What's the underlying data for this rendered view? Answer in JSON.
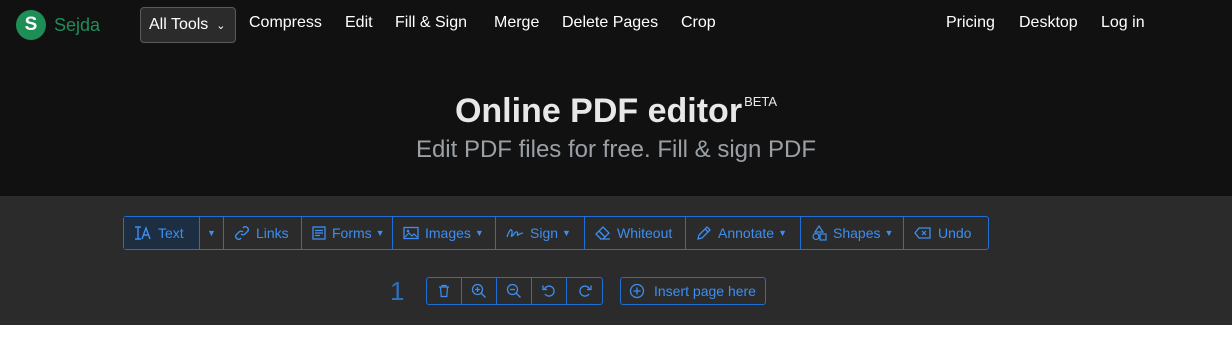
{
  "app": {
    "logo_letter": "S",
    "logo_text": "Sejda",
    "brand_color": "#1e8e57"
  },
  "nav": {
    "all_tools": "All Tools",
    "links": [
      "Compress",
      "Edit",
      "Fill & Sign",
      "Merge",
      "Delete Pages",
      "Crop"
    ],
    "right": [
      "Pricing",
      "Desktop",
      "Log in"
    ]
  },
  "hero": {
    "title": "Online PDF editor",
    "badge": "BETA",
    "subtitle": "Edit PDF files for free. Fill & sign PDF"
  },
  "toolbar": {
    "accent": "#3d8ef0",
    "items": [
      {
        "label": "Text",
        "icon": "text-cursor-icon"
      },
      {
        "label": "",
        "icon": "caret-down-icon"
      },
      {
        "label": "Links",
        "icon": "link-icon"
      },
      {
        "label": "Forms",
        "icon": "form-icon"
      },
      {
        "label": "Images",
        "icon": "image-icon"
      },
      {
        "label": "Sign",
        "icon": "signature-icon"
      },
      {
        "label": "Whiteout",
        "icon": "eraser-icon"
      },
      {
        "label": "Annotate",
        "icon": "pen-icon"
      },
      {
        "label": "Shapes",
        "icon": "shapes-icon"
      },
      {
        "label": "Undo",
        "icon": "undo-icon"
      }
    ]
  },
  "page": {
    "number": "1",
    "insert_label": "Insert page here"
  }
}
